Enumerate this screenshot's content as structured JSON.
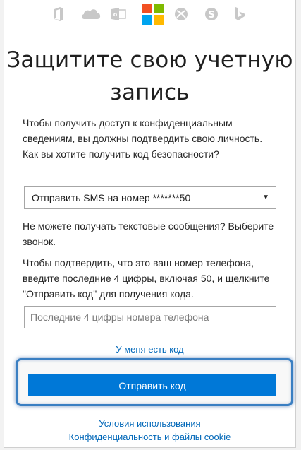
{
  "header": {
    "icons": [
      "office-icon",
      "onedrive-icon",
      "outlook-icon",
      "microsoft-logo",
      "xbox-icon",
      "skype-icon",
      "bing-icon"
    ],
    "colors": {
      "red": "#f25022",
      "green": "#7fba00",
      "blue": "#00a4ef",
      "yellow": "#ffb900",
      "icon_gray": "#c8c8c8"
    }
  },
  "title": "Защитите свою учетную запись",
  "intro": "Чтобы получить доступ к конфиденциальным сведениям, вы должны подтвердить свою личность. Как вы хотите получить код безопасности?",
  "method_select": {
    "selected": "Отправить SMS на номер *******50"
  },
  "cant_receive_text": "Не можете получать текстовые сообщения? Выберите звонок.",
  "confirm_instructions": "Чтобы подтвердить, что это ваш номер телефона, введите последние 4 цифры, включая 50, и щелкните \"Отправить код\" для получения кода.",
  "code_input": {
    "placeholder": "Последние 4 цифры номера телефона",
    "value": ""
  },
  "have_code_link": "У меня есть код",
  "send_button": "Отправить код",
  "footer": {
    "terms": "Условия использования",
    "privacy": "Конфиденциальность и файлы cookie"
  },
  "accent_color": "#0078d7",
  "link_color": "#0067b8"
}
